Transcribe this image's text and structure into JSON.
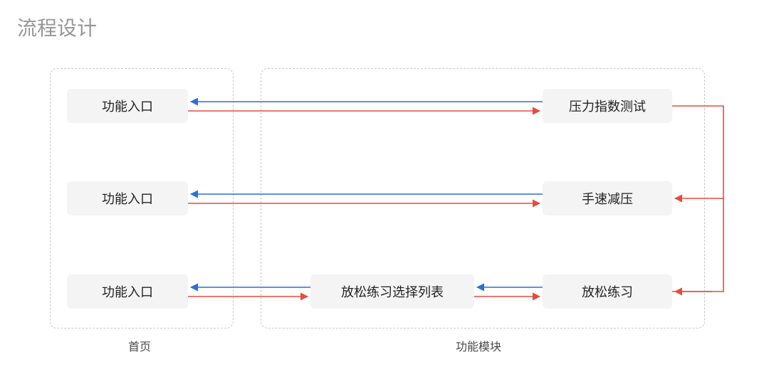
{
  "title": "流程设计",
  "groups": {
    "homepage": {
      "label": "首页"
    },
    "modules": {
      "label": "功能模块"
    }
  },
  "nodes": {
    "entry1": "功能入口",
    "entry2": "功能入口",
    "entry3": "功能入口",
    "stress_test": "压力指数测试",
    "speed_relief": "手速减压",
    "relax_list": "放松练习选择列表",
    "relax_practice": "放松练习"
  },
  "colors": {
    "blue": "#2a6fd6",
    "red": "#e84b3c",
    "box_bg": "#f4f4f4",
    "dash": "#c8c8c8",
    "title": "#969696"
  }
}
